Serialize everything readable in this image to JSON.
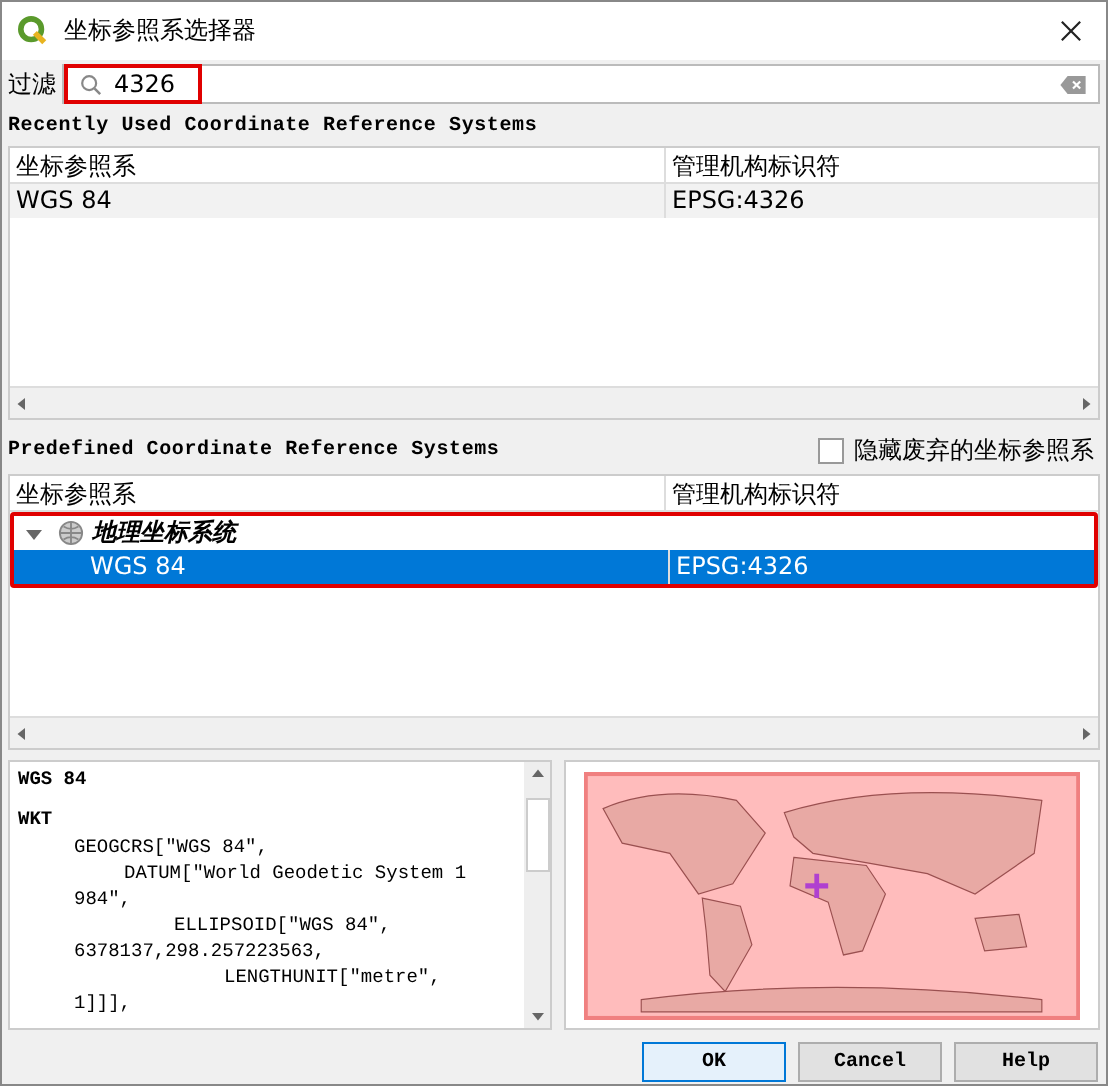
{
  "window": {
    "title": "坐标参照系选择器"
  },
  "filter": {
    "label": "过滤",
    "value": "4326"
  },
  "recent": {
    "heading": "Recently Used Coordinate Reference Systems",
    "columns": [
      "坐标参照系",
      "管理机构标识符"
    ],
    "rows": [
      {
        "name": "WGS 84",
        "authority_id": "EPSG:4326",
        "selected": false
      }
    ]
  },
  "predefined": {
    "heading": "Predefined Coordinate Reference Systems",
    "hide_deprecated": {
      "label": "隐藏废弃的坐标参照系",
      "checked": false
    },
    "columns": [
      "坐标参照系",
      "管理机构标识符"
    ],
    "groups": [
      {
        "name": "地理坐标系统",
        "expanded": true,
        "children": [
          {
            "name": "WGS 84",
            "authority_id": "EPSG:4326",
            "selected": true
          }
        ]
      }
    ]
  },
  "details": {
    "title": "WGS 84",
    "section": "WKT",
    "lines": [
      "GEOGCRS[\"WGS 84\",",
      "DATUM[\"World Geodetic System 1",
      "984\",",
      "ELLIPSOID[\"WGS 84\",",
      "6378137,298.257223563,",
      "LENGTHUNIT[\"metre\",",
      "1]]],"
    ]
  },
  "buttons": [
    "OK",
    "Cancel",
    "Help"
  ]
}
